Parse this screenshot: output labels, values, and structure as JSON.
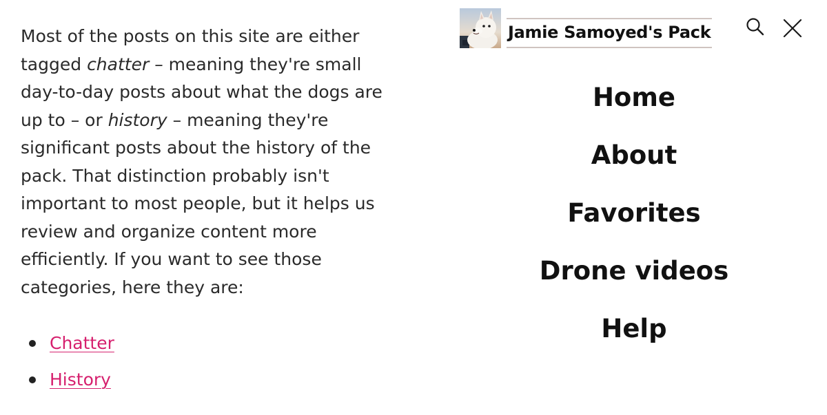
{
  "article": {
    "lines": [
      {
        "pre": "Most of the posts on this site are either",
        "em": "",
        "post": ""
      },
      {
        "pre": "tagged ",
        "em": "chatter",
        "post": " – meaning they're small"
      },
      {
        "pre": "day-to-day posts about what the dogs are",
        "em": "",
        "post": ""
      },
      {
        "pre": "up to – or ",
        "em": "history",
        "post": " – meaning they're"
      },
      {
        "pre": "significant posts about the history of the",
        "em": "",
        "post": ""
      },
      {
        "pre": "pack. That distinction probably isn't",
        "em": "",
        "post": ""
      },
      {
        "pre": "important to most people, but it helps us",
        "em": "",
        "post": ""
      },
      {
        "pre": "review and organize content more",
        "em": "",
        "post": ""
      },
      {
        "pre": "efficiently. If you want to see those",
        "em": "",
        "post": ""
      },
      {
        "pre": "categories, here they are:",
        "em": "",
        "post": ""
      }
    ]
  },
  "categories": [
    {
      "label": "Chatter"
    },
    {
      "label": "History"
    }
  ],
  "header": {
    "site_title": "Jamie Samoyed's Pack",
    "logo_icon": "samoyed-logo",
    "search_icon": "search-icon",
    "close_icon": "close-icon"
  },
  "menu": {
    "items": [
      {
        "label": "Home"
      },
      {
        "label": "About"
      },
      {
        "label": "Favorites"
      },
      {
        "label": "Drone videos"
      },
      {
        "label": "Help"
      }
    ]
  },
  "colors": {
    "link": "#d6206e",
    "text": "#2a2a2a",
    "menu_text": "#111111"
  }
}
